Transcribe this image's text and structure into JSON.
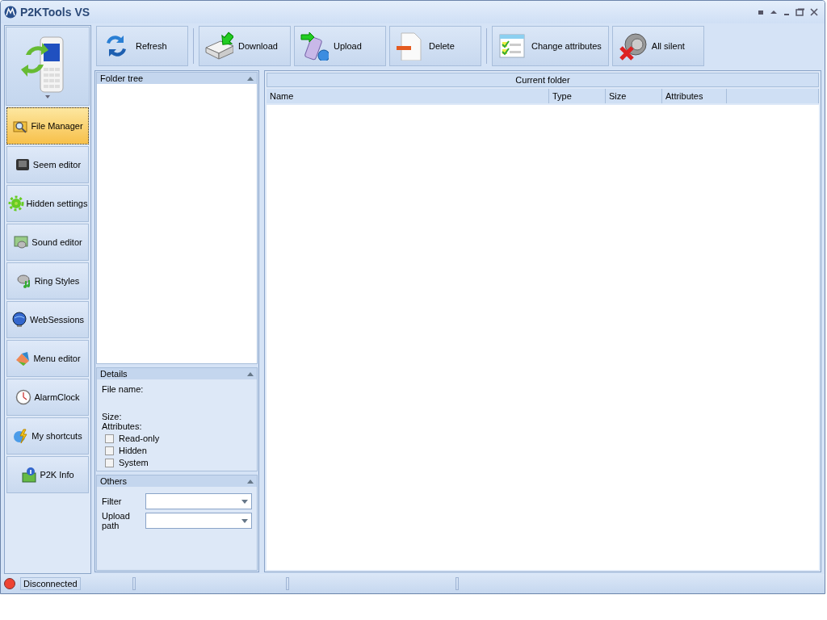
{
  "window": {
    "title": "P2KTools VS"
  },
  "sidebar": {
    "items": [
      {
        "label": "File Manager",
        "selected": true
      },
      {
        "label": "Seem editor",
        "selected": false
      },
      {
        "label": "Hidden settings",
        "selected": false
      },
      {
        "label": "Sound editor",
        "selected": false
      },
      {
        "label": "Ring Styles",
        "selected": false
      },
      {
        "label": "WebSessions",
        "selected": false
      },
      {
        "label": "Menu editor",
        "selected": false
      },
      {
        "label": "AlarmClock",
        "selected": false
      },
      {
        "label": "My shortcuts",
        "selected": false
      },
      {
        "label": "P2K Info",
        "selected": false
      }
    ]
  },
  "toolbar": {
    "buttons": [
      {
        "label": "Refresh",
        "separator_before": false
      },
      {
        "label": "Download",
        "separator_before": true
      },
      {
        "label": "Upload",
        "separator_before": false
      },
      {
        "label": "Delete",
        "separator_before": false
      },
      {
        "label": "Change attributes",
        "separator_before": true
      },
      {
        "label": "All silent",
        "separator_before": false
      }
    ]
  },
  "folder_tree": {
    "title": "Folder tree"
  },
  "details": {
    "title": "Details",
    "file_name_label": "File name:",
    "size_label": "Size:",
    "attributes_label": "Attributes:",
    "attributes": [
      {
        "label": "Read-only",
        "checked": false
      },
      {
        "label": "Hidden",
        "checked": false
      },
      {
        "label": "System",
        "checked": false
      }
    ]
  },
  "others": {
    "title": "Others",
    "fields": [
      {
        "label": "Filter"
      },
      {
        "label": "Upload path"
      }
    ]
  },
  "file_list": {
    "title": "Current folder",
    "columns": [
      "Name",
      "Type",
      "Size",
      "Attributes"
    ]
  },
  "status_bar": {
    "status": "Disconnected",
    "connected": false
  }
}
